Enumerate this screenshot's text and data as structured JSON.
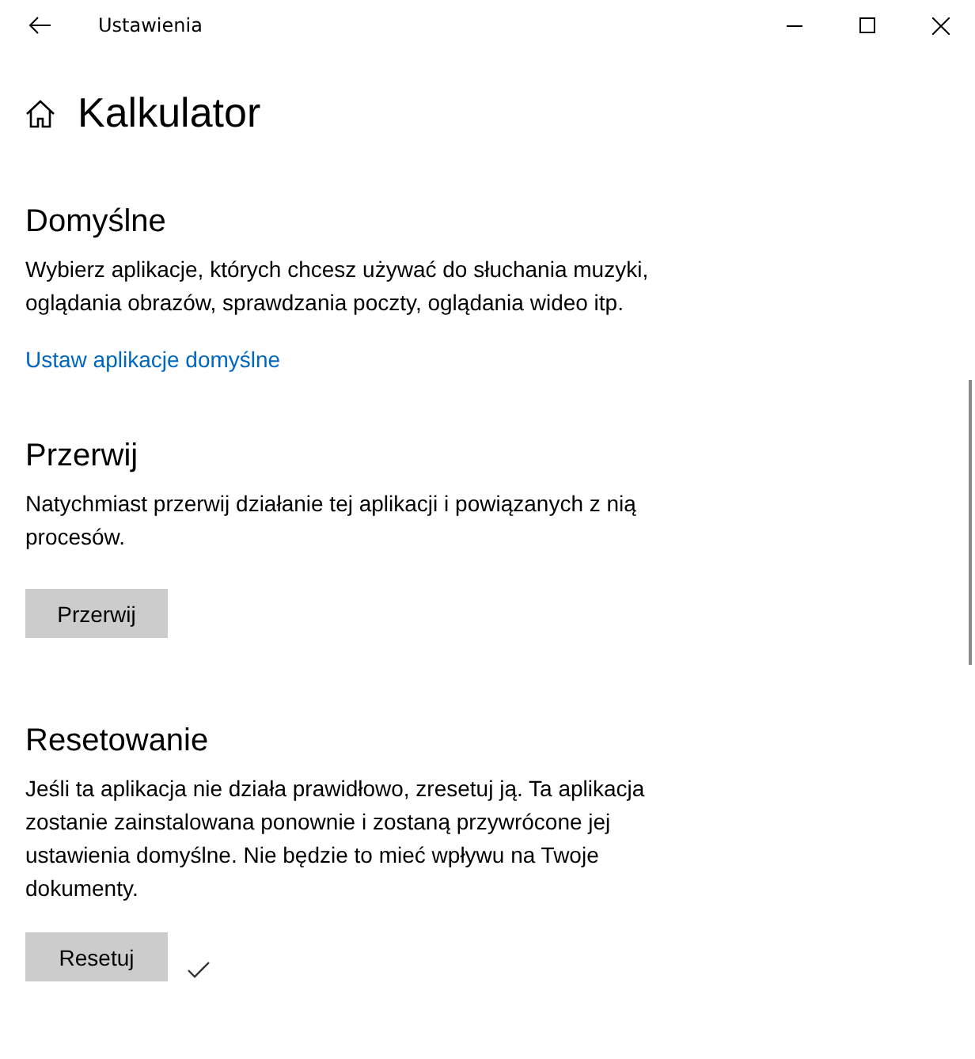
{
  "window": {
    "title": "Ustawienia"
  },
  "page": {
    "title": "Kalkulator"
  },
  "sections": [
    {
      "heading": "Domyślne",
      "text": "Wybierz aplikacje, których chcesz używać do słuchania muzyki, oglądania obrazów, sprawdzania poczty, oglądania wideo itp.",
      "action": {
        "kind": "link",
        "label": "Ustaw aplikacje domyślne"
      }
    },
    {
      "heading": "Przerwij",
      "text": "Natychmiast przerwij działanie tej aplikacji i powiązanych z nią procesów.",
      "action": {
        "kind": "button",
        "label": "Przerwij",
        "completed": false
      }
    },
    {
      "heading": "Resetowanie",
      "text": "Jeśli ta aplikacja nie działa prawidłowo, zresetuj ją. Ta aplikacja zostanie zainstalowana ponownie i zostaną przywrócone jej ustawienia domyślne. Nie będzie to mieć wpływu na Twoje dokumenty.",
      "action": {
        "kind": "button",
        "label": "Resetuj",
        "completed": true
      }
    }
  ]
}
